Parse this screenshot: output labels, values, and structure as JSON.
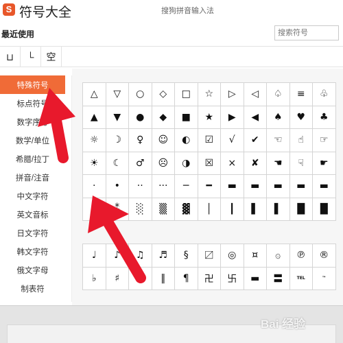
{
  "window": {
    "logo_letter": "S",
    "title": "符号大全",
    "ime_name": "搜狗拼音输入法"
  },
  "recent": {
    "label": "最近使用",
    "items": [
      "⊔",
      "└",
      "空"
    ]
  },
  "search": {
    "placeholder": "搜索符号"
  },
  "sidebar": {
    "items": [
      {
        "label": "特殊符号",
        "active": true
      },
      {
        "label": "标点符号"
      },
      {
        "label": "数字序号"
      },
      {
        "label": "数学/单位"
      },
      {
        "label": "希腊/拉丁"
      },
      {
        "label": "拼音/注音"
      },
      {
        "label": "中文字符"
      },
      {
        "label": "英文音标"
      },
      {
        "label": "日文字符"
      },
      {
        "label": "韩文字符"
      },
      {
        "label": "俄文字母"
      },
      {
        "label": "制表符"
      }
    ]
  },
  "grid": {
    "rows": [
      [
        "△",
        "▽",
        "○",
        "◇",
        "□",
        "☆",
        "▷",
        "◁",
        "♤",
        "≡",
        "♧"
      ],
      [
        "▲",
        "▼",
        "●",
        "◆",
        "■",
        "★",
        "▶",
        "◀",
        "♠",
        "♥",
        "♣"
      ],
      [
        "☼",
        "☽",
        "♀",
        "☺",
        "◐",
        "☑",
        "√",
        "✔",
        "☜",
        "☝",
        "☞"
      ],
      [
        "☀",
        "☾",
        "♂",
        "☹",
        "◑",
        "☒",
        "×",
        "✘",
        "☚",
        "☟",
        "☛"
      ],
      [
        "·",
        "•",
        "··",
        "···",
        "─",
        "━",
        "▬",
        "▬",
        "▬",
        "▬",
        "▬"
      ],
      [
        "⁚",
        "⁑",
        "░",
        "▒",
        "▓",
        "│",
        "┃",
        "▌",
        "▌",
        "█",
        "█"
      ]
    ]
  },
  "grid2": {
    "rows": [
      [
        "♩",
        "♪",
        "♫",
        "♬",
        "§",
        "〼",
        "◎",
        "¤",
        "۞",
        "℗",
        "®"
      ],
      [
        "♭",
        "♯",
        "♮",
        "‖",
        "¶",
        "卍",
        "卐",
        "▬",
        "〓",
        "TEL",
        "™"
      ]
    ]
  },
  "watermark": "Bai 经验",
  "colors": {
    "accent": "#f06b37",
    "arrow": "#e8192c",
    "grid_line": "#d4d4d4"
  }
}
